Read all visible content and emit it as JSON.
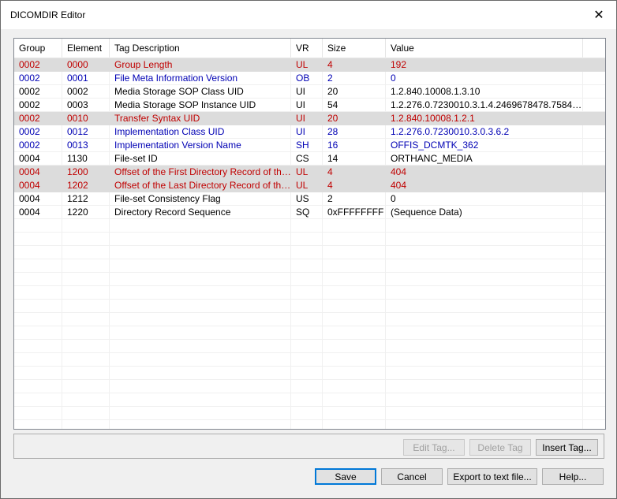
{
  "window": {
    "title": "DICOMDIR Editor",
    "close_glyph": "✕"
  },
  "columns": [
    "Group",
    "Element",
    "Tag Description",
    "VR",
    "Size",
    "Value"
  ],
  "rows": [
    {
      "group": "0002",
      "element": "0000",
      "desc": "Group Length",
      "vr": "UL",
      "size": "4",
      "value": "192",
      "color": "red",
      "selected": true
    },
    {
      "group": "0002",
      "element": "0001",
      "desc": "File Meta Information Version",
      "vr": "OB",
      "size": "2",
      "value": "0",
      "color": "blue",
      "selected": false
    },
    {
      "group": "0002",
      "element": "0002",
      "desc": "Media Storage SOP Class UID",
      "vr": "UI",
      "size": "20",
      "value": "1.2.840.10008.1.3.10",
      "color": "black",
      "selected": false
    },
    {
      "group": "0002",
      "element": "0003",
      "desc": "Media Storage SOP Instance UID",
      "vr": "UI",
      "size": "54",
      "value": "1.2.276.0.7230010.3.1.4.2469678478.7584.1...",
      "color": "black",
      "selected": false
    },
    {
      "group": "0002",
      "element": "0010",
      "desc": "Transfer Syntax UID",
      "vr": "UI",
      "size": "20",
      "value": "1.2.840.10008.1.2.1",
      "color": "red",
      "selected": true
    },
    {
      "group": "0002",
      "element": "0012",
      "desc": "Implementation Class UID",
      "vr": "UI",
      "size": "28",
      "value": "1.2.276.0.7230010.3.0.3.6.2",
      "color": "blue",
      "selected": false
    },
    {
      "group": "0002",
      "element": "0013",
      "desc": "Implementation Version Name",
      "vr": "SH",
      "size": "16",
      "value": "OFFIS_DCMTK_362",
      "color": "blue",
      "selected": false
    },
    {
      "group": "0004",
      "element": "1130",
      "desc": "File-set ID",
      "vr": "CS",
      "size": "14",
      "value": "ORTHANC_MEDIA",
      "color": "black",
      "selected": false
    },
    {
      "group": "0004",
      "element": "1200",
      "desc": "Offset of the First Directory Record of the ...",
      "vr": "UL",
      "size": "4",
      "value": "404",
      "color": "red",
      "selected": true
    },
    {
      "group": "0004",
      "element": "1202",
      "desc": "Offset of the Last Directory Record of the ...",
      "vr": "UL",
      "size": "4",
      "value": "404",
      "color": "red",
      "selected": true
    },
    {
      "group": "0004",
      "element": "1212",
      "desc": "File-set Consistency Flag",
      "vr": "US",
      "size": "2",
      "value": "0",
      "color": "black",
      "selected": false
    },
    {
      "group": "0004",
      "element": "1220",
      "desc": "Directory Record Sequence",
      "vr": "SQ",
      "size": "0xFFFFFFFF",
      "value": "(Sequence Data)",
      "color": "black",
      "selected": false
    }
  ],
  "tag_buttons": {
    "edit": "Edit Tag...",
    "delete": "Delete Tag",
    "insert": "Insert Tag..."
  },
  "dialog_buttons": {
    "save": "Save",
    "cancel": "Cancel",
    "export": "Export to text file...",
    "help": "Help..."
  },
  "colors": {
    "red": "#c00000",
    "blue": "#0000b4",
    "black": "#000000",
    "selected_bg": "#dcdcdc",
    "accent": "#0078d7"
  }
}
